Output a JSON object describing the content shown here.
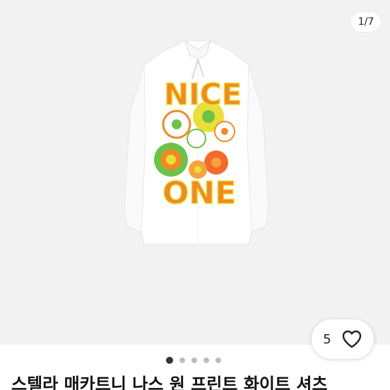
{
  "gallery": {
    "counter": "1/7",
    "slides": 7,
    "active_slide": 1,
    "artwork_words": [
      "NICE",
      "ONE"
    ]
  },
  "like": {
    "count": "5",
    "icon": "heart-outline-icon"
  },
  "product": {
    "title": "스텔라 매카트니 나스 원 프린트 화이트 셔츠"
  },
  "colors": {
    "accent_orange": "#f08a24",
    "accent_green": "#6cc24a",
    "accent_yellow": "#e9df38",
    "background": "#f2f2f2"
  }
}
